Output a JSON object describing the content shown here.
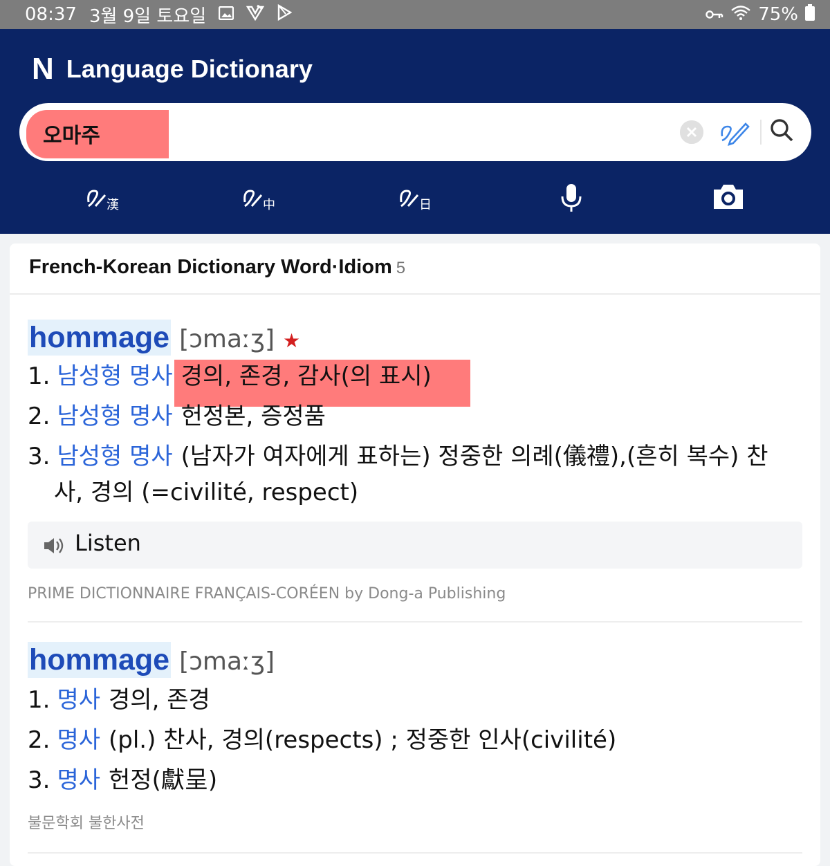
{
  "status_bar": {
    "time": "08:37",
    "date": "3월 9일 토요일",
    "battery": "75%"
  },
  "header": {
    "logo": "N",
    "title": "Language Dictionary",
    "search_value": "오마주",
    "toolbar_icons": [
      "hanja-handwriting-icon",
      "chinese-handwriting-icon",
      "japanese-handwriting-icon",
      "microphone-icon",
      "camera-icon"
    ]
  },
  "section": {
    "title": "French-Korean Dictionary Word·Idiom",
    "count": "5"
  },
  "entries": [
    {
      "headword": "hommage",
      "pronunciation": "[ɔmaːʒ]",
      "star": "★",
      "senses": [
        {
          "num": "1.",
          "pos": "남성형 명사",
          "def": "경의, 존경, 감사(의 표시)"
        },
        {
          "num": "2.",
          "pos": "남성형 명사",
          "def": "헌정본, 증정품"
        },
        {
          "num": "3.",
          "pos": "남성형 명사",
          "def": "(남자가 여자에게 표하는) 정중한 의례(儀禮),(흔히 복수) 찬",
          "def_cont": "사, 경의 (=civilité, respect)"
        }
      ],
      "listen_label": "Listen",
      "source": "PRIME DICTIONNAIRE FRANÇAIS-CORÉEN by Dong-a Publishing"
    },
    {
      "headword": "hommage",
      "pronunciation": "[ɔmaːʒ]",
      "senses": [
        {
          "num": "1.",
          "pos": "명사",
          "def": "경의, 존경"
        },
        {
          "num": "2.",
          "pos": "명사",
          "def": "(pl.) 찬사, 경의(respects) ; 정중한 인사(civilité)"
        },
        {
          "num": "3.",
          "pos": "명사",
          "def": "헌정(獻呈)"
        }
      ],
      "source": "불문학회 불한사전"
    }
  ],
  "colors": {
    "header_bg": "#0b2465",
    "headword": "#1e4bb8",
    "pos": "#2b65d9",
    "highlight": "#ff7b7b",
    "star": "#d31f1f"
  }
}
